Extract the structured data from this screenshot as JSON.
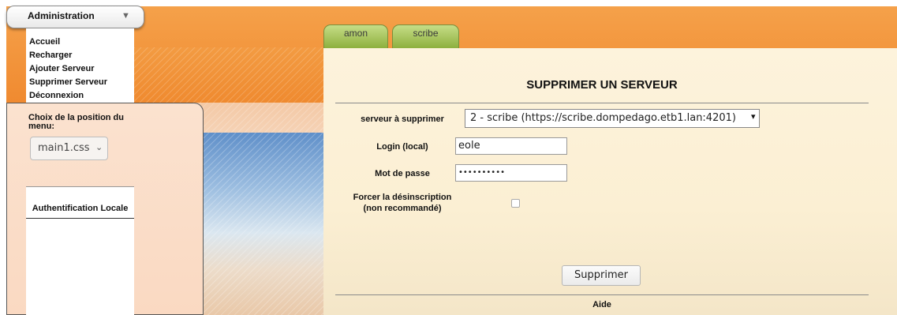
{
  "admin_menu": {
    "title": "Administration",
    "chevron_icon": "triangle-down-icon"
  },
  "sidebar": {
    "items": [
      {
        "label": "Accueil"
      },
      {
        "label": "Recharger"
      },
      {
        "label": "Ajouter Serveur"
      },
      {
        "label": "Supprimer Serveur"
      },
      {
        "label": "Déconnexion"
      }
    ],
    "menu_position": {
      "label": "Choix de la position du menu:",
      "selected": "main1.css"
    },
    "auth_title": "Authentification Locale"
  },
  "tabs": [
    {
      "label": "amon"
    },
    {
      "label": "scribe"
    }
  ],
  "form": {
    "title": "SUPPRIMER UN SERVEUR",
    "server_label": "serveur à supprimer",
    "server_selected": "2 - scribe (https://scribe.dompedago.etb1.lan:4201)",
    "login_label": "Login (local)",
    "login_value": "eole",
    "password_label": "Mot de passe",
    "password_value": "••••••••••",
    "force_label_line1": "Forcer la désinscription",
    "force_label_line2": "(non recommandé)",
    "force_checked": false,
    "submit_label": "Supprimer",
    "help_title": "Aide"
  },
  "colors": {
    "orange": "#f08a30",
    "tab_green": "#8db03e",
    "panel": "#fbefd3"
  }
}
